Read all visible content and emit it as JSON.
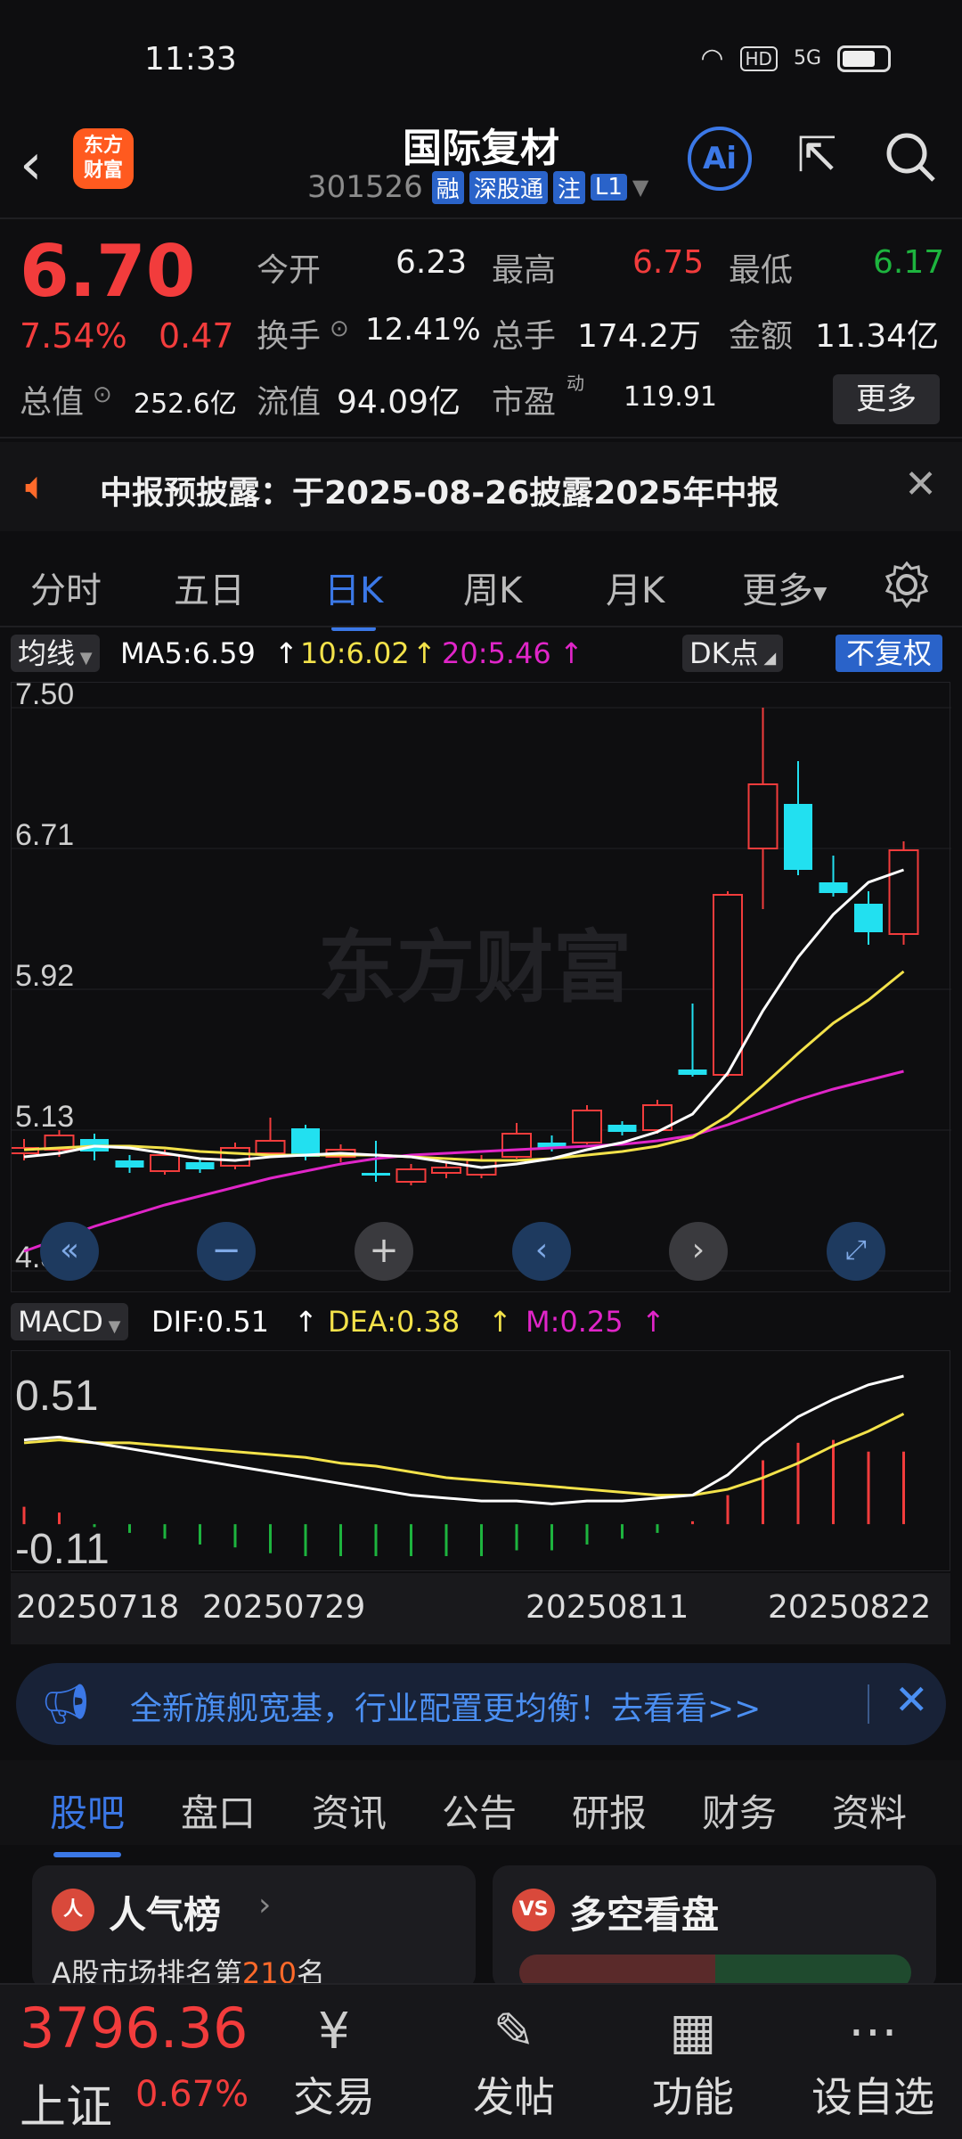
{
  "status": {
    "time": "11:33",
    "hd": "HD",
    "net": "5G"
  },
  "header": {
    "logo_text": "东方财富",
    "title": "国际复材",
    "code": "301526",
    "tags": [
      "融",
      "深股通",
      "注",
      "L1"
    ]
  },
  "quote": {
    "price": "6.70",
    "pct": "7.54%",
    "change": "0.47",
    "open_label": "今开",
    "open": "6.23",
    "high_label": "最高",
    "high": "6.75",
    "low_label": "最低",
    "low": "6.17",
    "turnover_label": "换手",
    "turnover": "12.41%",
    "volume_label": "总手",
    "volume": "174.2万",
    "amount_label": "金额",
    "amount": "11.34亿",
    "mcap_label": "总值",
    "mcap": "252.6亿",
    "float_label": "流值",
    "float": "94.09亿",
    "pe_label": "市盈",
    "pe_sup": "动",
    "pe": "119.91",
    "more": "更多"
  },
  "notice": {
    "text": "中报预披露：于2025-08-26披露2025年中报"
  },
  "period_tabs": [
    "分时",
    "五日",
    "日K",
    "周K",
    "月K",
    "更多"
  ],
  "ma_row": {
    "chip": "均线",
    "ma5": "MA5:6.59",
    "ma10": "10:6.02",
    "ma20": "20:5.46",
    "dk": "DK点",
    "fq": "不复权"
  },
  "chart_data": {
    "type": "candlestick",
    "y_ticks": [
      "7.50",
      "6.71",
      "5.92",
      "5.13",
      "4.34"
    ],
    "ylim": [
      4.34,
      7.5
    ],
    "watermark": "东方财富",
    "candles": [
      {
        "o": 5.0,
        "c": 5.03,
        "h": 5.08,
        "l": 4.96
      },
      {
        "o": 5.02,
        "c": 5.1,
        "h": 5.13,
        "l": 4.98
      },
      {
        "o": 5.08,
        "c": 5.01,
        "h": 5.11,
        "l": 4.96
      },
      {
        "o": 4.96,
        "c": 4.92,
        "h": 4.99,
        "l": 4.89
      },
      {
        "o": 4.9,
        "c": 4.99,
        "h": 5.02,
        "l": 4.88
      },
      {
        "o": 4.95,
        "c": 4.91,
        "h": 4.97,
        "l": 4.89
      },
      {
        "o": 4.93,
        "c": 5.03,
        "h": 5.06,
        "l": 4.91
      },
      {
        "o": 5.0,
        "c": 5.07,
        "h": 5.2,
        "l": 4.98
      },
      {
        "o": 5.14,
        "c": 4.98,
        "h": 5.16,
        "l": 4.96
      },
      {
        "o": 4.98,
        "c": 5.02,
        "h": 5.05,
        "l": 4.95
      },
      {
        "o": 4.89,
        "c": 4.88,
        "h": 5.07,
        "l": 4.84
      },
      {
        "o": 4.84,
        "c": 4.91,
        "h": 4.94,
        "l": 4.82
      },
      {
        "o": 4.89,
        "c": 4.92,
        "h": 4.95,
        "l": 4.86
      },
      {
        "o": 4.88,
        "c": 4.96,
        "h": 4.99,
        "l": 4.86
      },
      {
        "o": 4.98,
        "c": 5.11,
        "h": 5.17,
        "l": 4.97
      },
      {
        "o": 5.06,
        "c": 5.03,
        "h": 5.1,
        "l": 5.01
      },
      {
        "o": 5.06,
        "c": 5.24,
        "h": 5.27,
        "l": 5.05
      },
      {
        "o": 5.16,
        "c": 5.12,
        "h": 5.18,
        "l": 5.1
      },
      {
        "o": 5.13,
        "c": 5.27,
        "h": 5.3,
        "l": 5.11
      },
      {
        "o": 5.47,
        "c": 5.44,
        "h": 5.84,
        "l": 5.43
      },
      {
        "o": 5.44,
        "c": 6.45,
        "h": 6.47,
        "l": 5.43
      },
      {
        "o": 6.71,
        "c": 7.07,
        "h": 7.5,
        "l": 6.37
      },
      {
        "o": 6.96,
        "c": 6.59,
        "h": 7.2,
        "l": 6.56
      },
      {
        "o": 6.52,
        "c": 6.46,
        "h": 6.67,
        "l": 6.44
      },
      {
        "o": 6.4,
        "c": 6.24,
        "h": 6.47,
        "l": 6.17
      },
      {
        "o": 6.23,
        "c": 6.7,
        "h": 6.75,
        "l": 6.17
      }
    ],
    "ma5": [
      4.98,
      5.0,
      5.04,
      5.03,
      5.0,
      4.97,
      4.96,
      4.98,
      4.99,
      5.0,
      4.99,
      4.98,
      4.95,
      4.92,
      4.94,
      4.97,
      5.02,
      5.06,
      5.12,
      5.22,
      5.45,
      5.8,
      6.1,
      6.34,
      6.52,
      6.59
    ],
    "ma10": [
      5.02,
      5.03,
      5.04,
      5.04,
      5.03,
      5.01,
      5.0,
      4.99,
      4.99,
      4.99,
      4.99,
      4.98,
      4.97,
      4.96,
      4.96,
      4.97,
      4.99,
      5.01,
      5.04,
      5.09,
      5.21,
      5.38,
      5.56,
      5.73,
      5.86,
      6.02
    ],
    "ma20": [
      4.45,
      4.52,
      4.59,
      4.65,
      4.71,
      4.76,
      4.81,
      4.86,
      4.9,
      4.94,
      4.97,
      4.99,
      5.0,
      5.01,
      5.02,
      5.03,
      5.04,
      5.05,
      5.07,
      5.1,
      5.16,
      5.23,
      5.3,
      5.36,
      5.41,
      5.46
    ]
  },
  "macd_row": {
    "chip": "MACD",
    "dif": "DIF:0.51",
    "dea": "DEA:0.38",
    "m": "M:0.25"
  },
  "macd_data": {
    "y_ticks": [
      "0.51",
      "-0.11"
    ],
    "ylim": [
      -0.11,
      0.51
    ],
    "dif": [
      0.29,
      0.3,
      0.28,
      0.26,
      0.24,
      0.22,
      0.2,
      0.18,
      0.16,
      0.14,
      0.12,
      0.1,
      0.09,
      0.08,
      0.08,
      0.07,
      0.08,
      0.08,
      0.09,
      0.1,
      0.17,
      0.28,
      0.37,
      0.43,
      0.48,
      0.51
    ],
    "dea": [
      0.28,
      0.29,
      0.28,
      0.28,
      0.27,
      0.26,
      0.25,
      0.24,
      0.23,
      0.21,
      0.2,
      0.18,
      0.16,
      0.15,
      0.14,
      0.13,
      0.12,
      0.11,
      0.1,
      0.1,
      0.12,
      0.16,
      0.21,
      0.27,
      0.32,
      0.38
    ],
    "hist": [
      0.06,
      0.04,
      -0.01,
      -0.03,
      -0.05,
      -0.07,
      -0.08,
      -0.1,
      -0.11,
      -0.11,
      -0.11,
      -0.11,
      -0.11,
      -0.11,
      -0.09,
      -0.09,
      -0.07,
      -0.05,
      -0.03,
      0.01,
      0.1,
      0.22,
      0.28,
      0.29,
      0.25,
      0.25
    ]
  },
  "dates": [
    "20250718",
    "20250729",
    "20250811",
    "20250822"
  ],
  "ad": {
    "text": "全新旗舰宽基，行业配置更均衡！去看看>>"
  },
  "section_tabs": [
    "股吧",
    "盘口",
    "资讯",
    "公告",
    "研报",
    "财务",
    "资料"
  ],
  "cards": [
    {
      "icon": "人",
      "name": "人气榜",
      "sub_pre": "A股市场排名第",
      "sub_num": "210",
      "sub_post": "名"
    },
    {
      "icon": "VS",
      "name": "多空看盘"
    }
  ],
  "bottom": {
    "index_price": "3796.36",
    "index_name": "上证",
    "index_pct": "0.67%",
    "nav": [
      {
        "label": "交易",
        "icon": "¥"
      },
      {
        "label": "发帖",
        "icon": "✎"
      },
      {
        "label": "功能",
        "icon": "▦"
      },
      {
        "label": "设自选",
        "icon": "⋯"
      }
    ]
  }
}
